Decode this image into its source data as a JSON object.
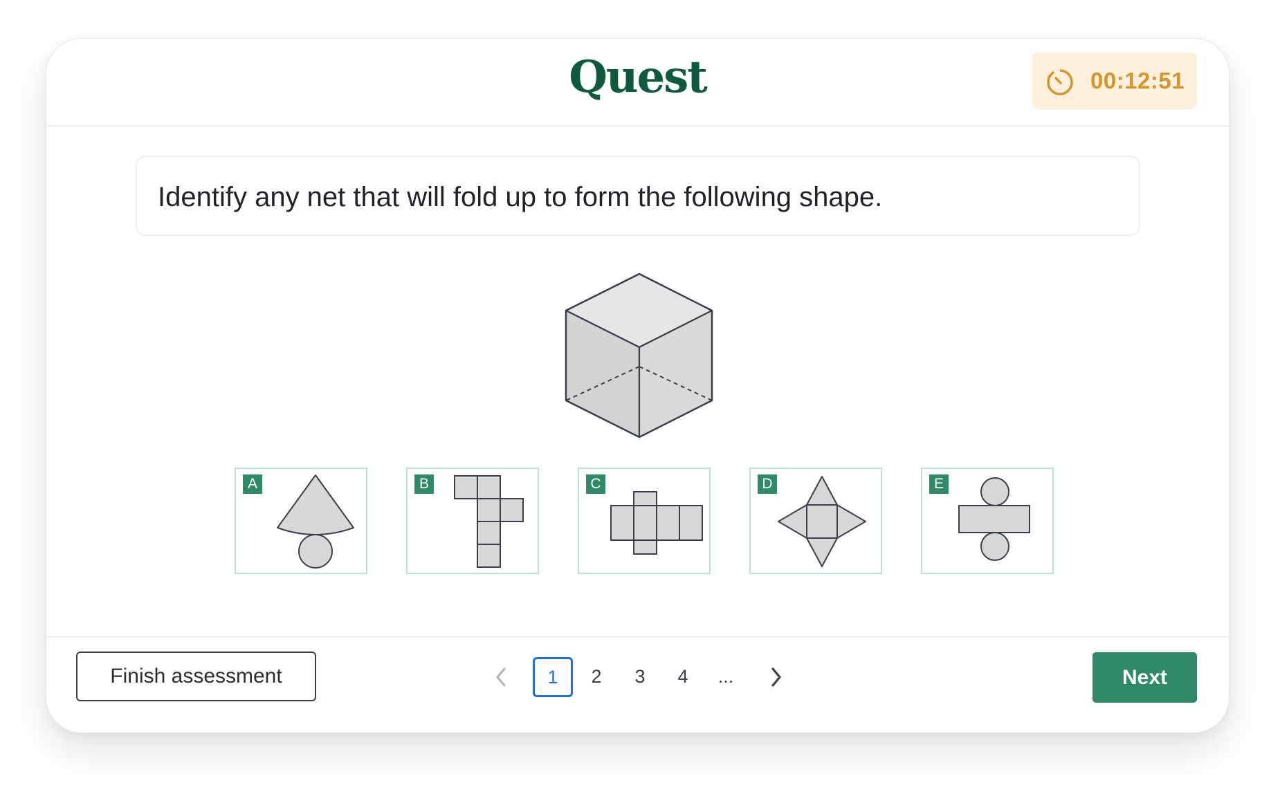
{
  "header": {
    "logo_text": "Quest",
    "timer": {
      "icon": "stopwatch-icon",
      "value": "00:12:51",
      "color": "#d6952b",
      "background": "#fdf1de"
    }
  },
  "question": {
    "text": "Identify any net that will fold up to form the following shape.",
    "shape_icon": "cube-illustration"
  },
  "options": [
    {
      "letter": "A",
      "net": "cone-net"
    },
    {
      "letter": "B",
      "net": "cube-net"
    },
    {
      "letter": "C",
      "net": "cuboid-net"
    },
    {
      "letter": "D",
      "net": "square-pyramid-net"
    },
    {
      "letter": "E",
      "net": "cylinder-net"
    }
  ],
  "footer": {
    "finish_label": "Finish assessment",
    "pagination": {
      "prev_icon": "chevron-left-icon",
      "pages": [
        "1",
        "2",
        "3",
        "4",
        "..."
      ],
      "current": "1",
      "next_icon": "chevron-right-icon"
    },
    "next_label": "Next"
  },
  "colors": {
    "brand": "#0f5a3c",
    "accent": "#2e8a67",
    "option_border": "#bfe3d1",
    "active_page": "#1f6fd6",
    "shape_fill": "#d8d8d8",
    "shape_stroke": "#3a3f4b"
  }
}
